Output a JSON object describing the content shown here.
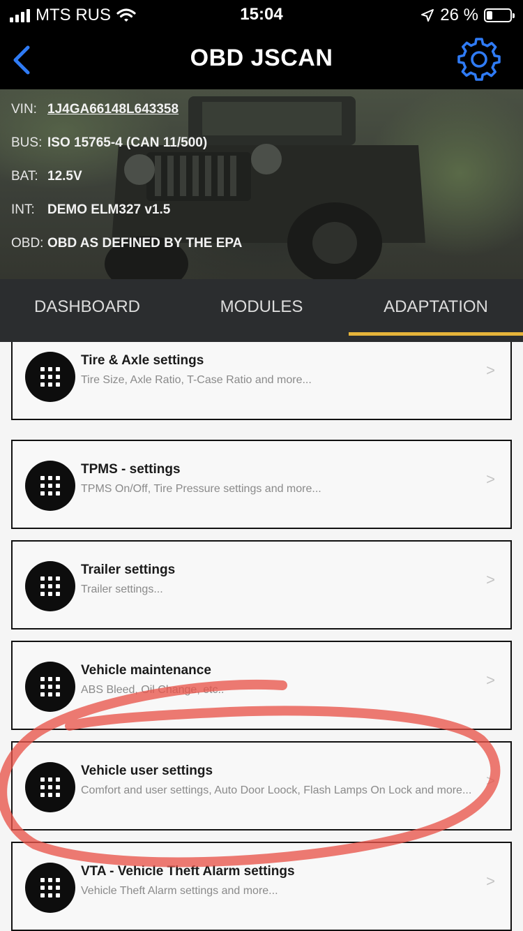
{
  "status_bar": {
    "carrier": "MTS RUS",
    "time": "15:04",
    "battery_percent": "26 %",
    "battery_level": 0.26,
    "icons": [
      "signal-icon",
      "wifi-icon",
      "location-arrow-icon",
      "battery-icon"
    ]
  },
  "header": {
    "title": "OBD JSCAN",
    "accent_color": "#2f7bf5",
    "back_icon": "chevron-left-icon",
    "settings_icon": "gear-icon"
  },
  "vehicle": {
    "rows": [
      {
        "key": "VIN:",
        "value": "1J4GA66148L643358"
      },
      {
        "key": "BUS:",
        "value": "ISO 15765-4 (CAN 11/500)"
      },
      {
        "key": "BAT:",
        "value": "12.5V"
      },
      {
        "key": "INT:",
        "value": "DEMO ELM327 v1.5"
      },
      {
        "key": "OBD:",
        "value": "OBD AS DEFINED BY THE EPA"
      }
    ]
  },
  "tabs": [
    {
      "label": "DASHBOARD",
      "active": false
    },
    {
      "label": "MODULES",
      "active": false
    },
    {
      "label": "ADAPTATION",
      "active": true
    }
  ],
  "tab_indicator_color": "#e6b43a",
  "items": [
    {
      "title": "Tire & Axle settings",
      "subtitle": "Tire Size, Axle Ratio, T-Case Ratio and more...",
      "arrow": ">"
    },
    {
      "title": "TPMS - settings",
      "subtitle": "TPMS On/Off, Tire Pressure settings and more...",
      "arrow": ">"
    },
    {
      "title": "Trailer settings",
      "subtitle": "Trailer settings...",
      "arrow": ">"
    },
    {
      "title": "Vehicle maintenance",
      "subtitle": "ABS Bleed, Oil Change, etc..",
      "arrow": ">"
    },
    {
      "title": "Vehicle user settings",
      "subtitle": "Comfort and user settings, Auto Door Loock, Flash Lamps On Lock and more...",
      "arrow": ">"
    },
    {
      "title": "VTA - Vehicle Theft Alarm settings",
      "subtitle": "Vehicle Theft Alarm settings and more...",
      "arrow": ">"
    }
  ],
  "annotation_color": "#e8554a"
}
